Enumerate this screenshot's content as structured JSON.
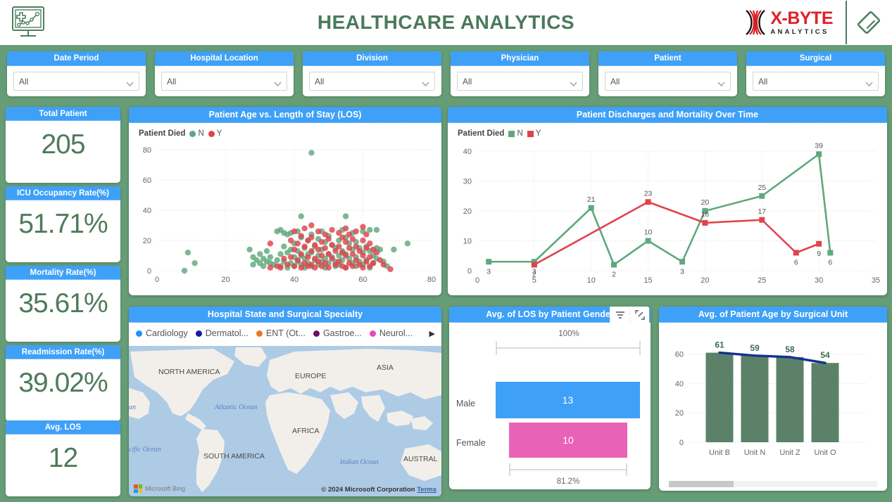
{
  "header": {
    "title": "HEALTHCARE ANALYTICS",
    "brand_icon": "healthcare-monitor-chart-icon",
    "logo_primary": "X-BYTE",
    "logo_secondary": "ANALYTICS",
    "logo_mark": "x-byte-dna-mark-icon",
    "diamond_icon": "diamond-logo-icon",
    "title_color": "#4a7a5c",
    "accent_blue": "#3fa0f7",
    "background_green": "#669c76"
  },
  "slicers": [
    {
      "label": "Date Period",
      "value": "All",
      "placeholder": "All"
    },
    {
      "label": "Hospital Location",
      "value": "All",
      "placeholder": "All"
    },
    {
      "label": "Division",
      "value": "All",
      "placeholder": "All"
    },
    {
      "label": "Physician",
      "value": "All",
      "placeholder": "All"
    },
    {
      "label": "Patient",
      "value": "All",
      "placeholder": "All"
    },
    {
      "label": "Surgical",
      "value": "All",
      "placeholder": "All"
    }
  ],
  "kpis": [
    {
      "label": "Total Patient",
      "value": "205"
    },
    {
      "label": "ICU Occupancy Rate(%)",
      "value": "51.71%"
    },
    {
      "label": "Mortality Rate(%)",
      "value": "35.61%"
    },
    {
      "label": "Readmission Rate(%)",
      "value": "39.02%"
    },
    {
      "label": "Avg. LOS",
      "value": "12"
    }
  ],
  "panels": {
    "scatter": {
      "title": "Patient Age vs. Length of Stay (LOS)"
    },
    "line": {
      "title": "Patient Discharges and Mortality Over Time"
    },
    "map": {
      "title": "Hospital State and Surgical Specialty"
    },
    "funnel": {
      "title": "Avg. of LOS by Patient Gender",
      "filter_icon": "filter-icon",
      "focus_icon": "focus-mode-icon"
    },
    "bar": {
      "title": "Avg. of Patient Age by Surgical Unit"
    }
  },
  "map": {
    "legend_title": "surgical-specialty-legend",
    "legend": [
      {
        "label": "Cardiology",
        "color": "#1e90ff"
      },
      {
        "label": "Dermatol...",
        "color": "#151c9e"
      },
      {
        "label": "ENT (Ot...",
        "color": "#e8772e"
      },
      {
        "label": "Gastroe...",
        "color": "#6b0f6b"
      },
      {
        "label": "Neurol...",
        "color": "#e849b8"
      }
    ],
    "more_arrow": "▶",
    "labels": [
      "NORTH AMERICA",
      "EUROPE",
      "ASIA",
      "Atlantic Ocean",
      "AFRICA",
      "Pacific Ocean",
      "SOUTH AMERICA",
      "Indian Ocean",
      "AUSTRAL"
    ],
    "attribution": "Microsoft Bing",
    "credit": "© 2024 Microsoft Corporation",
    "terms": "Terms"
  },
  "chart_data": [
    {
      "id": "scatter",
      "type": "scatter",
      "title": "Patient Age vs. Length of Stay (LOS)",
      "xlabel": "",
      "ylabel": "",
      "xlim": [
        0,
        80
      ],
      "ylim": [
        0,
        80
      ],
      "xticks": [
        0,
        20,
        40,
        60,
        80
      ],
      "yticks": [
        0,
        20,
        40,
        60,
        80
      ],
      "grid": true,
      "legend_title": "Patient Died",
      "legend_position": "top-left",
      "series": [
        {
          "name": "N",
          "color": "#5fa87d",
          "points": [
            [
              8,
              0
            ],
            [
              9,
              12
            ],
            [
              11,
              5
            ],
            [
              27,
              14
            ],
            [
              28,
              9
            ],
            [
              28,
              4
            ],
            [
              29,
              7
            ],
            [
              30,
              11
            ],
            [
              30,
              5
            ],
            [
              31,
              8
            ],
            [
              31,
              3
            ],
            [
              32,
              6
            ],
            [
              32,
              13
            ],
            [
              33,
              5
            ],
            [
              33,
              9
            ],
            [
              34,
              4
            ],
            [
              35,
              26
            ],
            [
              35,
              7
            ],
            [
              36,
              27
            ],
            [
              36,
              11
            ],
            [
              36,
              3
            ],
            [
              37,
              25
            ],
            [
              37,
              16
            ],
            [
              37,
              6
            ],
            [
              38,
              24
            ],
            [
              38,
              12
            ],
            [
              38,
              2
            ],
            [
              39,
              25
            ],
            [
              39,
              14
            ],
            [
              39,
              5
            ],
            [
              40,
              18
            ],
            [
              40,
              9
            ],
            [
              40,
              3
            ],
            [
              41,
              26
            ],
            [
              41,
              13
            ],
            [
              41,
              6
            ],
            [
              42,
              36
            ],
            [
              42,
              22
            ],
            [
              42,
              10
            ],
            [
              42,
              4
            ],
            [
              43,
              15
            ],
            [
              43,
              8
            ],
            [
              43,
              2
            ],
            [
              44,
              20
            ],
            [
              44,
              11
            ],
            [
              44,
              5
            ],
            [
              45,
              78
            ],
            [
              45,
              24
            ],
            [
              45,
              12
            ],
            [
              45,
              3
            ],
            [
              46,
              16
            ],
            [
              46,
              7
            ],
            [
              47,
              21
            ],
            [
              47,
              10
            ],
            [
              47,
              4
            ],
            [
              48,
              26
            ],
            [
              48,
              14
            ],
            [
              48,
              6
            ],
            [
              49,
              19
            ],
            [
              49,
              8
            ],
            [
              49,
              2
            ],
            [
              50,
              23
            ],
            [
              50,
              11
            ],
            [
              50,
              5
            ],
            [
              51,
              17
            ],
            [
              51,
              9
            ],
            [
              52,
              15
            ],
            [
              52,
              6
            ],
            [
              52,
              3
            ],
            [
              53,
              20
            ],
            [
              53,
              10
            ],
            [
              53,
              4
            ],
            [
              54,
              27
            ],
            [
              54,
              13
            ],
            [
              54,
              7
            ],
            [
              55,
              36
            ],
            [
              55,
              22
            ],
            [
              55,
              11
            ],
            [
              55,
              2
            ],
            [
              56,
              18
            ],
            [
              56,
              8
            ],
            [
              57,
              25
            ],
            [
              57,
              14
            ],
            [
              57,
              5
            ],
            [
              58,
              19
            ],
            [
              58,
              9
            ],
            [
              58,
              3
            ],
            [
              59,
              15
            ],
            [
              59,
              6
            ],
            [
              60,
              26
            ],
            [
              60,
              12
            ],
            [
              60,
              4
            ],
            [
              61,
              16
            ],
            [
              61,
              7
            ],
            [
              62,
              27
            ],
            [
              62,
              13
            ],
            [
              62,
              2
            ],
            [
              63,
              10
            ],
            [
              63,
              5
            ],
            [
              64,
              27
            ],
            [
              64,
              15
            ],
            [
              64,
              8
            ],
            [
              65,
              14
            ],
            [
              66,
              6
            ],
            [
              67,
              3
            ],
            [
              69,
              14
            ],
            [
              73,
              18
            ]
          ]
        },
        {
          "name": "Y",
          "color": "#e0434c",
          "points": [
            [
              33,
              18
            ],
            [
              33,
              2
            ],
            [
              35,
              3
            ],
            [
              36,
              2
            ],
            [
              37,
              8
            ],
            [
              38,
              4
            ],
            [
              39,
              20
            ],
            [
              39,
              9
            ],
            [
              40,
              26
            ],
            [
              40,
              14
            ],
            [
              40,
              3
            ],
            [
              41,
              18
            ],
            [
              41,
              7
            ],
            [
              42,
              23
            ],
            [
              42,
              11
            ],
            [
              42,
              2
            ],
            [
              43,
              28
            ],
            [
              43,
              16
            ],
            [
              43,
              5
            ],
            [
              44,
              20
            ],
            [
              44,
              9
            ],
            [
              44,
              3
            ],
            [
              45,
              30
            ],
            [
              45,
              22
            ],
            [
              45,
              13
            ],
            [
              45,
              4
            ],
            [
              46,
              17
            ],
            [
              46,
              8
            ],
            [
              46,
              2
            ],
            [
              47,
              26
            ],
            [
              47,
              14
            ],
            [
              47,
              6
            ],
            [
              48,
              19
            ],
            [
              48,
              10
            ],
            [
              48,
              3
            ],
            [
              49,
              24
            ],
            [
              49,
              15
            ],
            [
              49,
              5
            ],
            [
              50,
              21
            ],
            [
              50,
              11
            ],
            [
              50,
              2
            ],
            [
              51,
              27
            ],
            [
              51,
              17
            ],
            [
              51,
              8
            ],
            [
              52,
              13
            ],
            [
              52,
              4
            ],
            [
              53,
              25
            ],
            [
              53,
              16
            ],
            [
              53,
              6
            ],
            [
              54,
              22
            ],
            [
              54,
              12
            ],
            [
              54,
              3
            ],
            [
              55,
              28
            ],
            [
              55,
              19
            ],
            [
              55,
              10
            ],
            [
              55,
              2
            ],
            [
              56,
              24
            ],
            [
              56,
              15
            ],
            [
              56,
              5
            ],
            [
              57,
              21
            ],
            [
              57,
              11
            ],
            [
              57,
              3
            ],
            [
              58,
              26
            ],
            [
              58,
              16
            ],
            [
              58,
              7
            ],
            [
              59,
              13
            ],
            [
              59,
              4
            ],
            [
              60,
              29
            ],
            [
              60,
              20
            ],
            [
              60,
              10
            ],
            [
              60,
              2
            ],
            [
              61,
              24
            ],
            [
              61,
              15
            ],
            [
              61,
              6
            ],
            [
              62,
              18
            ],
            [
              62,
              9
            ],
            [
              62,
              3
            ],
            [
              63,
              14
            ],
            [
              63,
              5
            ],
            [
              64,
              12
            ],
            [
              65,
              7
            ],
            [
              66,
              4
            ],
            [
              68,
              1
            ]
          ]
        }
      ]
    },
    {
      "id": "line",
      "type": "line",
      "title": "Patient Discharges and Mortality Over Time",
      "xlabel": "",
      "ylabel": "",
      "xlim": [
        0,
        35
      ],
      "ylim": [
        0,
        40
      ],
      "xticks": [
        0,
        5,
        10,
        15,
        20,
        25,
        30,
        35
      ],
      "yticks": [
        0,
        10,
        20,
        30,
        40
      ],
      "grid": true,
      "legend_title": "Patient Died",
      "legend_position": "top-left",
      "show_data_labels": true,
      "series": [
        {
          "name": "N",
          "color": "#5fa87d",
          "x": [
            1,
            5,
            10,
            12,
            15,
            18,
            20,
            25,
            30,
            31
          ],
          "values": [
            3,
            3,
            21,
            2,
            10,
            3,
            20,
            25,
            39,
            6
          ]
        },
        {
          "name": "Y",
          "color": "#e0434c",
          "x": [
            5,
            15,
            20,
            25,
            28,
            30
          ],
          "values": [
            2,
            23,
            16,
            17,
            6,
            9
          ]
        }
      ]
    },
    {
      "id": "funnel",
      "type": "bar",
      "orientation": "horizontal",
      "title": "Avg. of LOS by Patient Gender",
      "categories": [
        "Male",
        "Female"
      ],
      "values": [
        13,
        10
      ],
      "colors": [
        "#3fa0f7",
        "#e863b6"
      ],
      "top_rate": "100%",
      "bottom_rate": "81.2%",
      "xlabel": "",
      "ylabel": ""
    },
    {
      "id": "bar",
      "type": "bar",
      "title": "Avg. of Patient Age by Surgical Unit",
      "categories": [
        "Unit B",
        "Unit N",
        "Unit Z",
        "Unit O"
      ],
      "values": [
        61,
        59,
        58,
        54
      ],
      "bar_color": "#5b8268",
      "trend_line": {
        "color": "#14328c",
        "values": [
          61,
          59,
          58,
          54
        ]
      },
      "ylim": [
        0,
        68
      ],
      "yticks": [
        0,
        20,
        40,
        60
      ],
      "xlabel": "",
      "ylabel": "",
      "grid": true,
      "scrollbar": true
    }
  ]
}
